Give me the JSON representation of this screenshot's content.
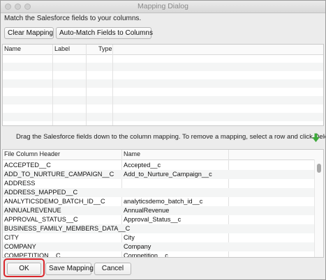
{
  "window": {
    "title": "Mapping Dialog"
  },
  "instruction": "Match the Salesforce fields to your columns.",
  "toolbar": {
    "clear_label": "Clear Mapping",
    "automatch_label": "Auto-Match Fields to Columns"
  },
  "fields_table": {
    "columns": [
      "Name",
      "Label",
      "Type"
    ]
  },
  "drag_hint": "Drag the Salesforce fields down to the column mapping.  To remove a mapping, select a row and click Delete.",
  "mapping_table": {
    "columns": [
      "File Column Header",
      "Name"
    ],
    "rows": [
      [
        "ACCEPTED__C",
        "Accepted__c"
      ],
      [
        "ADD_TO_NURTURE_CAMPAIGN__C",
        "Add_to_Nurture_Campaign__c"
      ],
      [
        "ADDRESS",
        ""
      ],
      [
        "ADDRESS_MAPPED__C",
        ""
      ],
      [
        "ANALYTICSDEMO_BATCH_ID__C",
        "analyticsdemo_batch_id__c"
      ],
      [
        "ANNUALREVENUE",
        "AnnualRevenue"
      ],
      [
        "APPROVAL_STATUS__C",
        "Approval_Status__c"
      ],
      [
        "BUSINESS_FAMILY_MEMBERS_DATA__C",
        ""
      ],
      [
        "CITY",
        "City"
      ],
      [
        "COMPANY",
        "Company"
      ],
      [
        "COMPETITION__C",
        "Competition__c"
      ]
    ]
  },
  "footer": {
    "ok_label": "OK",
    "save_label": "Save Mapping",
    "cancel_label": "Cancel"
  },
  "colors": {
    "highlight": "#d9252b",
    "arrow": "#3da83a"
  },
  "icons": {
    "down_arrow": "down-arrow-icon"
  }
}
